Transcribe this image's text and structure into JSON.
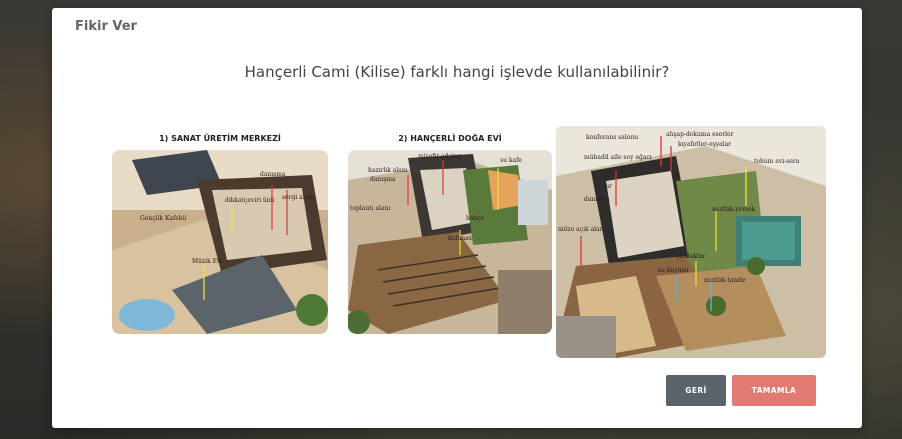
{
  "modal": {
    "title": "Fikir Ver",
    "question": "Hançerli Cami (Kilise) farklı hangi işlevde kullanılabilinir?"
  },
  "options": [
    {
      "label": "1) SANAT ÜRETİM MERKEZİ",
      "annotations": [
        "danışma",
        "dikkatçeviri ünü",
        "sergi alanı",
        "Gençlik Kafebü",
        "Müzik Evi"
      ]
    },
    {
      "label": "2) HANÇERLİ DOĞA EVİ",
      "annotations": [
        "misafir odaları",
        "su kafe",
        "hazırlık alanı",
        "danışma",
        "toplantı alanı",
        "bahçe",
        "kulünas"
      ]
    },
    {
      "label": "",
      "annotations": [
        "konferans salonu",
        "ahşap-dokuma eserler",
        "kıyafetler-eşyalar",
        "mübadil aile soy ağacı",
        "tohum evi-sera",
        "sır",
        "danışma",
        "müze açık alan",
        "mutfak-yemek",
        "çardaklar",
        "su kuyusu",
        "mutfak-tandır"
      ]
    }
  ],
  "buttons": {
    "back": "GERİ",
    "finish": "TAMAMLA"
  },
  "colors": {
    "back_button": "#5a636b",
    "finish_button": "#e07a72",
    "modal_bg": "#ffffff"
  }
}
